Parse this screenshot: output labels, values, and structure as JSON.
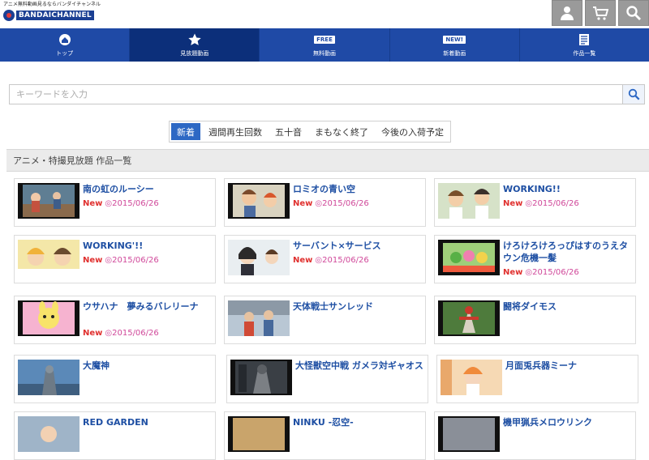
{
  "header": {
    "tagline": "アニメ無料動画見るならバンダイチャンネル",
    "logo_text": "BANDAICHANNEL",
    "icons": [
      "user-icon",
      "cart-icon",
      "search-icon"
    ]
  },
  "nav": {
    "items": [
      {
        "label": "トップ",
        "icon": "home-icon"
      },
      {
        "label": "見放題動画",
        "icon": "star-icon"
      },
      {
        "label": "無料動画",
        "badge": "FREE"
      },
      {
        "label": "新着動画",
        "badge": "NEW!"
      },
      {
        "label": "作品一覧",
        "icon": "list-icon"
      }
    ],
    "active_index": 1
  },
  "search": {
    "placeholder": "キーワードを入力",
    "value": ""
  },
  "tabs": {
    "items": [
      "新着",
      "週間再生回数",
      "五十音",
      "まもなく終了",
      "今後の入荷予定"
    ],
    "active_index": 0
  },
  "section": {
    "title": "アニメ・特撮見放題 作品一覧"
  },
  "colors": {
    "nav_bg": "#1f4aa6",
    "nav_active": "#0c2f7a",
    "title_blue": "#1e4fa3",
    "new_red": "#e0312f",
    "date_pink": "#d0489a"
  },
  "cards": [
    {
      "title": "南の虹のルーシー",
      "new": "New",
      "date": "◎2015/06/26"
    },
    {
      "title": "ロミオの青い空",
      "new": "New",
      "date": "◎2015/06/26"
    },
    {
      "title": "WORKING!!",
      "new": "New",
      "date": "◎2015/06/26"
    },
    {
      "title": "WORKING'!!",
      "new": "New",
      "date": "◎2015/06/26"
    },
    {
      "title": "サーバント×サービス",
      "new": "New",
      "date": "◎2015/06/26"
    },
    {
      "title": "けろけろけろっぴはすのうえタウン危機一髪",
      "new": "New",
      "date": "◎2015/06/26"
    },
    {
      "title": "ウサハナ　夢みるバレリーナ",
      "new": "New",
      "date": "◎2015/06/26"
    },
    {
      "title": "天体戦士サンレッド",
      "new": "",
      "date": ""
    },
    {
      "title": "闘将ダイモス",
      "new": "",
      "date": ""
    },
    {
      "title": "大魔神",
      "new": "",
      "date": ""
    },
    {
      "title": "大怪獣空中戦 ガメラ対ギャオス",
      "new": "",
      "date": ""
    },
    {
      "title": "月面兎兵器ミーナ",
      "new": "",
      "date": ""
    },
    {
      "title": "RED GARDEN",
      "new": "",
      "date": ""
    },
    {
      "title": "NINKU -忍空-",
      "new": "",
      "date": ""
    },
    {
      "title": "機甲猟兵メロウリンク",
      "new": "",
      "date": ""
    }
  ]
}
